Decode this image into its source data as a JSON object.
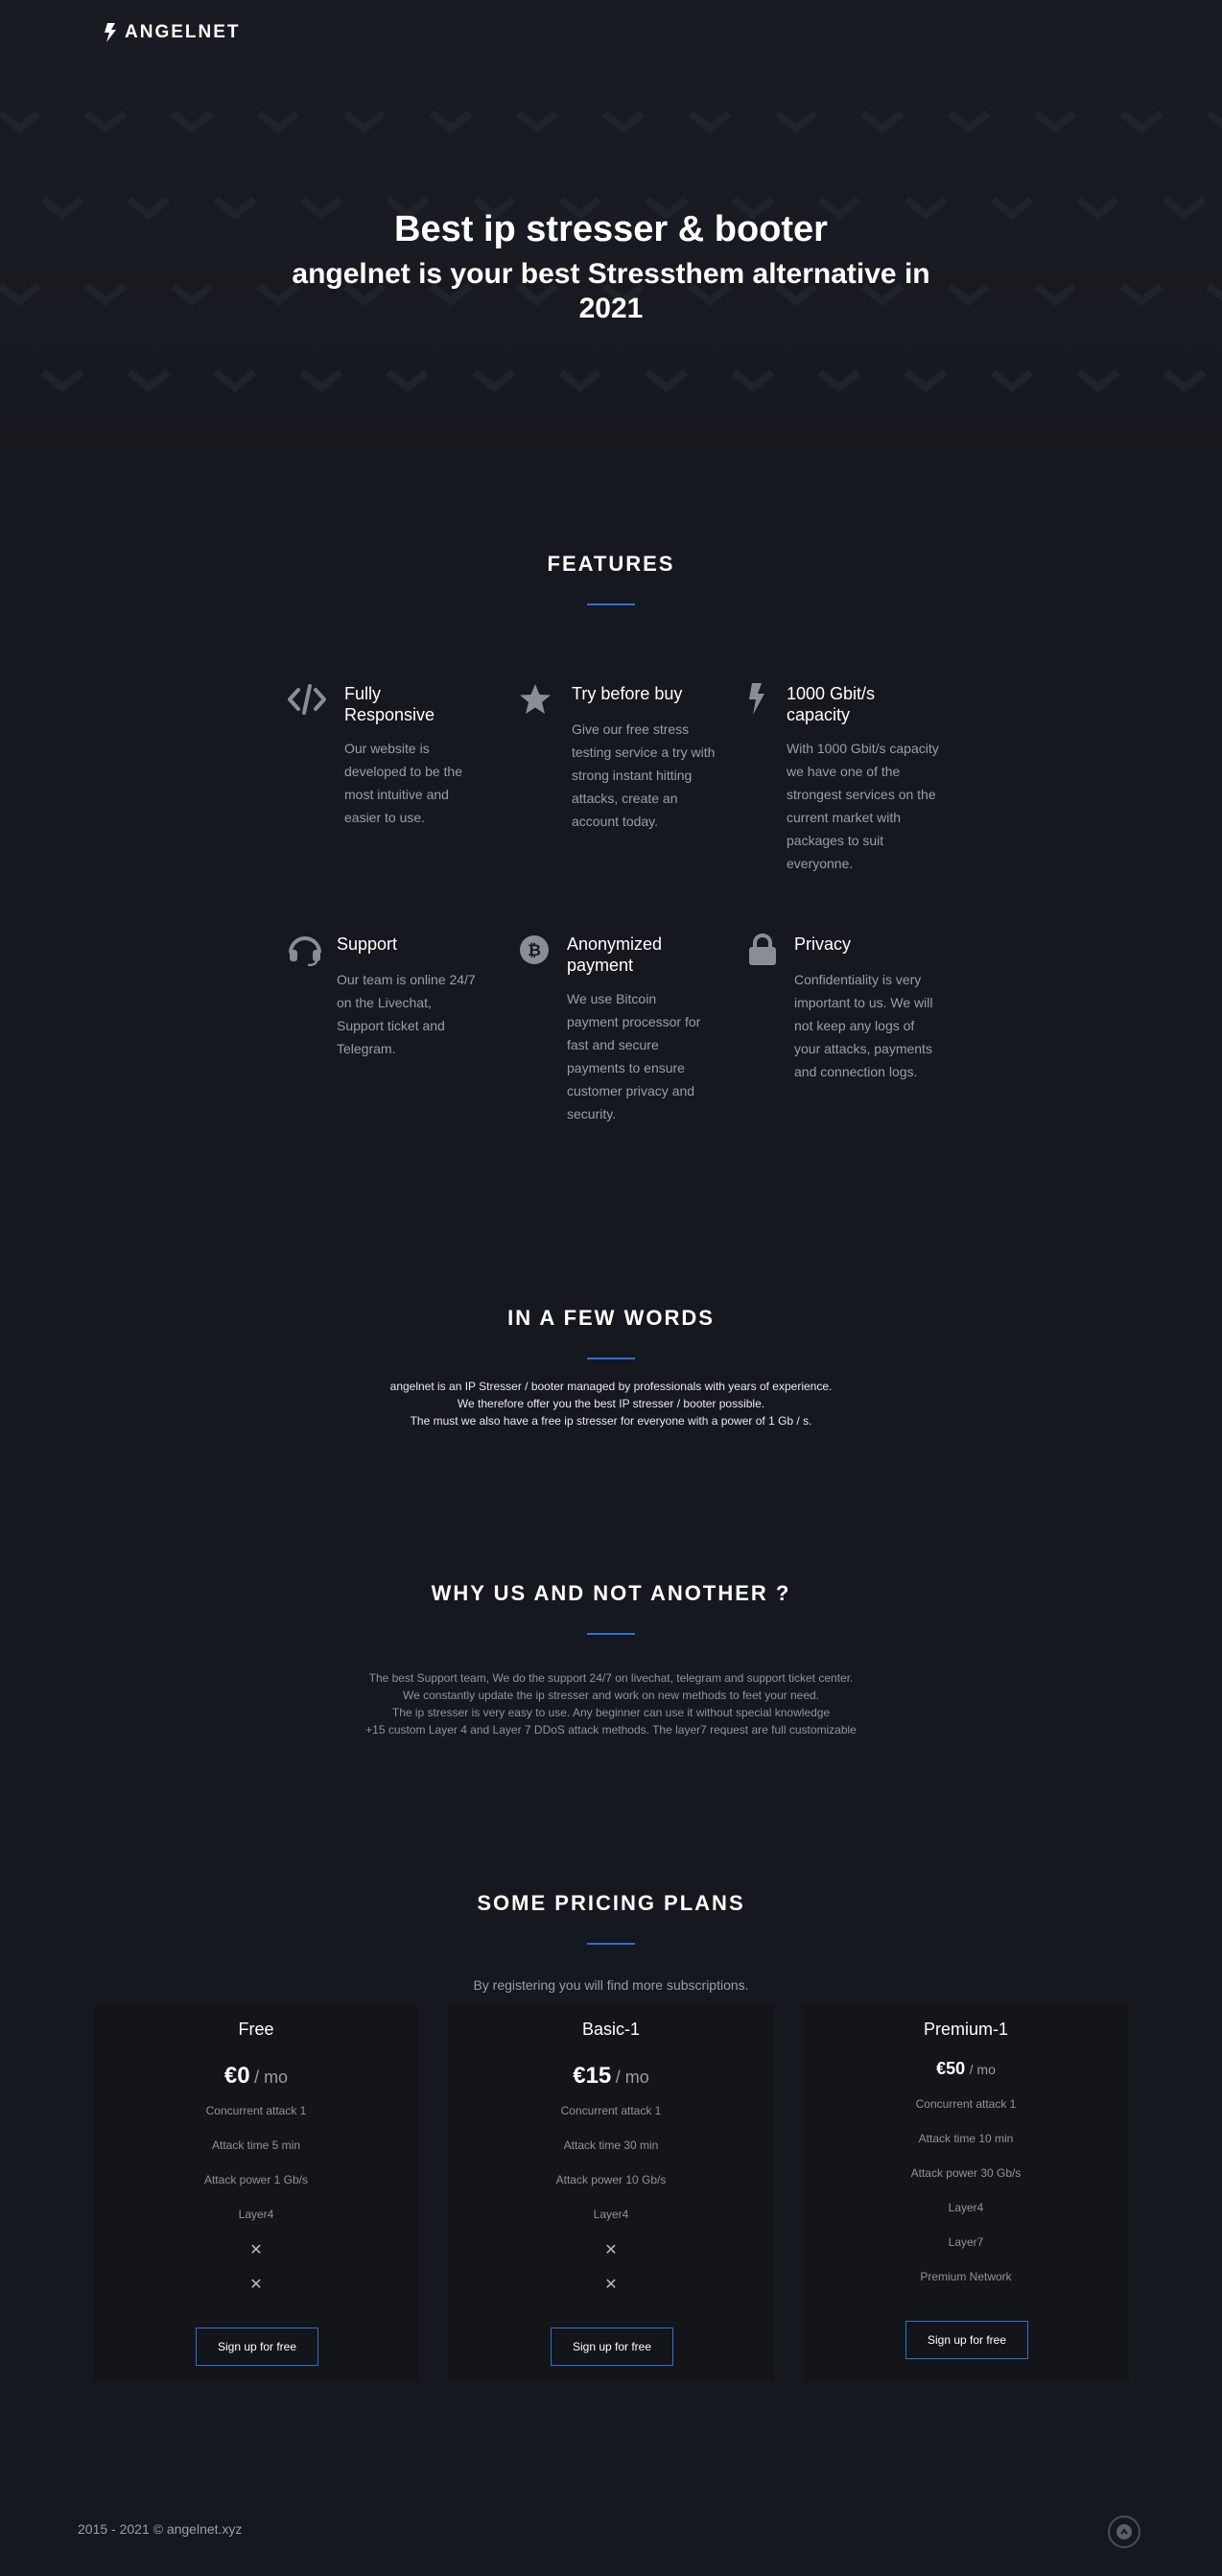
{
  "header": {
    "brand": "ANGELNET",
    "brand_icon": "bolt-icon"
  },
  "hero": {
    "title": "Best ip stresser & booter",
    "subtitle": "angelnet is your best Stressthem alternative in 2021"
  },
  "features": {
    "heading": "FEATURES",
    "items": [
      {
        "icon": "code-icon",
        "title": "Fully Responsive",
        "desc": "Our website is developed to be the most intuitive and easier to use."
      },
      {
        "icon": "star-icon",
        "title": "Try before buy",
        "desc": "Give our free stress testing service a try with strong instant hitting attacks, create an account today."
      },
      {
        "icon": "bolt-icon",
        "title": "1000 Gbit/s capacity",
        "desc": "With 1000 Gbit/s capacity we have one of the strongest services on the current market with packages to suit everyonne."
      },
      {
        "icon": "headset-icon",
        "title": "Support",
        "desc": "Our team is online 24/7 on the Livechat, Support ticket and Telegram."
      },
      {
        "icon": "bitcoin-icon",
        "title": "Anonymized payment",
        "desc": "We use Bitcoin payment processor for fast and secure payments to ensure customer privacy and security."
      },
      {
        "icon": "lock-icon",
        "title": "Privacy",
        "desc": "Confidentiality is very important to us. We will not keep any logs of your attacks, payments and connection logs."
      }
    ]
  },
  "words": {
    "heading": "IN A FEW WORDS",
    "lines": [
      "angelnet is an IP Stresser / booter managed by professionals with years of experience.",
      "We therefore offer you the best IP stresser / booter possible.",
      "The must we also have a free ip stresser for everyone with a power of 1 Gb / s."
    ]
  },
  "why": {
    "heading": "WHY US AND NOT ANOTHER ?",
    "lines": [
      "The best Support team, We do the support 24/7 on livechat, telegram and support ticket center.",
      "We constantly update the ip stresser and work on new methods to feet your need.",
      "The ip stresser is very easy to use. Any beginner can use it without special knowledge",
      "+15 custom Layer 4 and Layer 7 DDoS attack methods. The layer7 request are full customizable"
    ]
  },
  "pricing": {
    "heading": "SOME PRICING PLANS",
    "intro": "By registering you will find more subscriptions.",
    "plans": [
      {
        "name": "Free",
        "price": "€0",
        "period": "/ mo",
        "features": [
          "Concurrent attack 1",
          "Attack time 5 min",
          "Attack power 1 Gb/s",
          "Layer4"
        ],
        "crossed": [
          "✕",
          "✕"
        ],
        "button": "Sign up for free"
      },
      {
        "name": "Basic-1",
        "price": "€15",
        "period": "/ mo",
        "features": [
          "Concurrent attack 1",
          "Attack time 30 min",
          "Attack power 10 Gb/s",
          "Layer4"
        ],
        "crossed": [
          "✕",
          "✕"
        ],
        "button": "Sign up for free"
      },
      {
        "name": "Premium-1",
        "price": "€50",
        "period": "/ mo",
        "features": [
          "Concurrent attack 1",
          "Attack time 10 min",
          "Attack power 30 Gb/s",
          "Layer4",
          "Layer7",
          "Premium Network"
        ],
        "crossed": [],
        "button": "Sign up for free"
      }
    ]
  },
  "footer": {
    "copyright": "2015 - 2021 © angelnet.xyz",
    "top_icon": "scroll-top-icon"
  },
  "colors": {
    "accent": "#2f6fd6",
    "background": "#15181e",
    "card": "#131519"
  }
}
